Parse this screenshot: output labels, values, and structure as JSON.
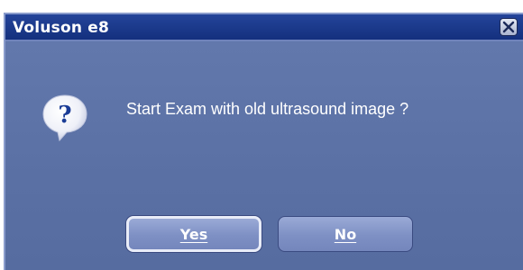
{
  "dialog": {
    "title": "Voluson e8",
    "message": "Start Exam with old ultrasound image ?",
    "buttons": {
      "yes_label": "Yes",
      "no_label": "No"
    },
    "icons": {
      "question": "question-icon",
      "close": "close-icon"
    },
    "colors": {
      "titlebar": "#1a388a",
      "body": "#5e74a8",
      "button": "#8496c8",
      "text": "#ffffff"
    }
  }
}
